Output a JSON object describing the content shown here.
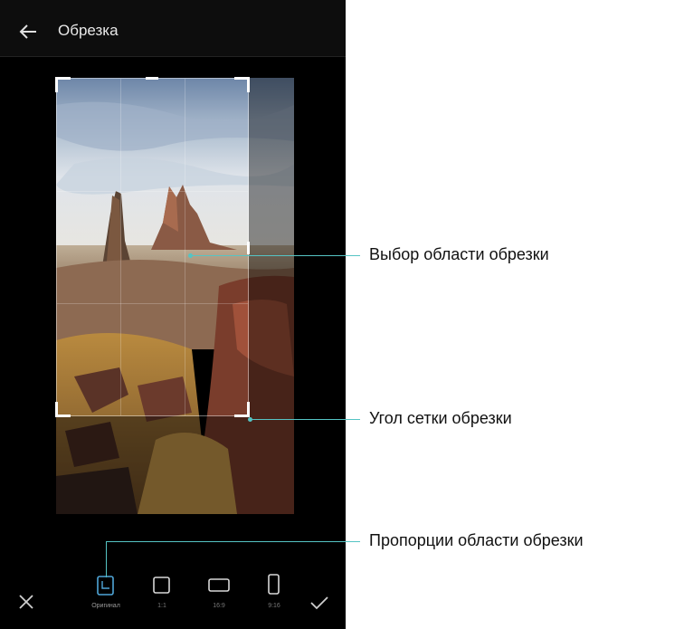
{
  "header": {
    "title": "Обрезка",
    "back_icon": "arrow-left-icon"
  },
  "toolbar": {
    "cancel_icon": "close-icon",
    "confirm_icon": "check-icon",
    "ratios": [
      {
        "label": "Оригинал",
        "icon": "original-ratio-icon",
        "selected": true
      },
      {
        "label": "1:1",
        "icon": "square-ratio-icon",
        "selected": false
      },
      {
        "label": "16:9",
        "icon": "landscape-ratio-icon",
        "selected": false
      },
      {
        "label": "9:16",
        "icon": "portrait-ratio-icon",
        "selected": false
      }
    ]
  },
  "callouts": {
    "crop_area": "Выбор области обрезки",
    "crop_corner": "Угол сетки обрезки",
    "crop_ratio": "Пропорции области обрезки"
  },
  "colors": {
    "accent": "#55c4c4",
    "background": "#000000"
  }
}
